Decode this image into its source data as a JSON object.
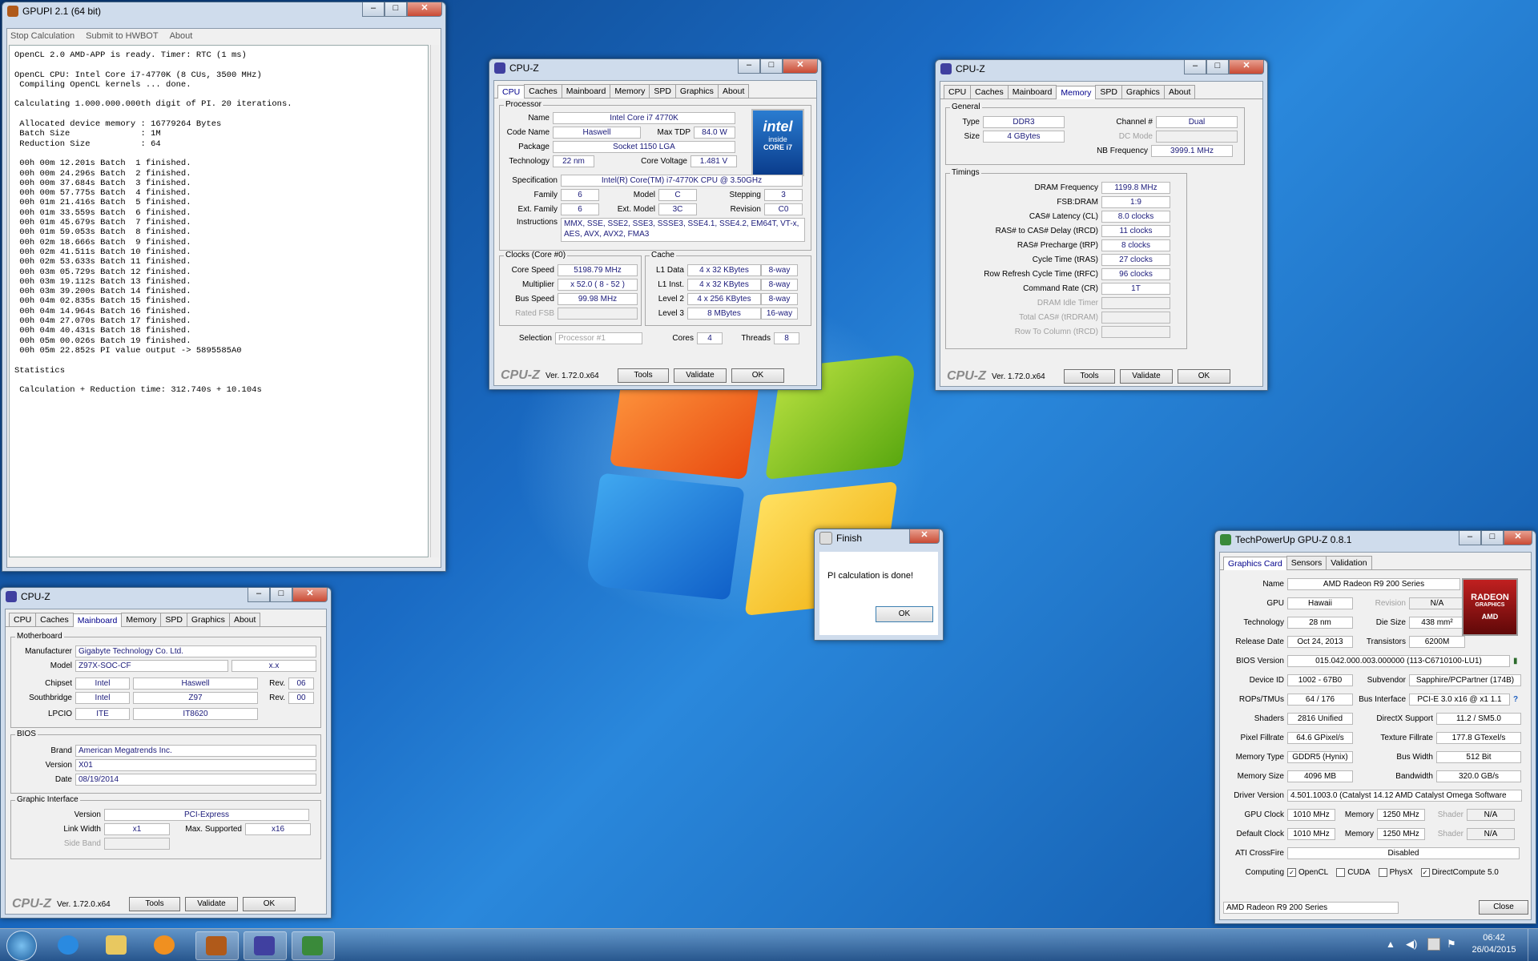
{
  "gpupi": {
    "title": "GPUPI 2.1 (64 bit)",
    "menu": [
      "Stop Calculation",
      "Submit to HWBOT",
      "About"
    ],
    "console": "OpenCL 2.0 AMD-APP is ready. Timer: RTC (1 ms)\n\nOpenCL CPU: Intel Core i7-4770K (8 CUs, 3500 MHz)\n Compiling OpenCL kernels ... done.\n\nCalculating 1.000.000.000th digit of PI. 20 iterations.\n\n Allocated device memory : 16779264 Bytes\n Batch Size              : 1M\n Reduction Size          : 64\n\n 00h 00m 12.201s Batch  1 finished.\n 00h 00m 24.296s Batch  2 finished.\n 00h 00m 37.684s Batch  3 finished.\n 00h 00m 57.775s Batch  4 finished.\n 00h 01m 21.416s Batch  5 finished.\n 00h 01m 33.559s Batch  6 finished.\n 00h 01m 45.679s Batch  7 finished.\n 00h 01m 59.053s Batch  8 finished.\n 00h 02m 18.666s Batch  9 finished.\n 00h 02m 41.511s Batch 10 finished.\n 00h 02m 53.633s Batch 11 finished.\n 00h 03m 05.729s Batch 12 finished.\n 00h 03m 19.112s Batch 13 finished.\n 00h 03m 39.200s Batch 14 finished.\n 00h 04m 02.835s Batch 15 finished.\n 00h 04m 14.964s Batch 16 finished.\n 00h 04m 27.070s Batch 17 finished.\n 00h 04m 40.431s Batch 18 finished.\n 00h 05m 00.026s Batch 19 finished.\n 00h 05m 22.852s PI value output -> 5895585A0\n\nStatistics\n\n Calculation + Reduction time: 312.740s + 10.104s"
  },
  "cpuz_cpu": {
    "title": "CPU-Z",
    "tabs": [
      "CPU",
      "Caches",
      "Mainboard",
      "Memory",
      "SPD",
      "Graphics",
      "About"
    ],
    "processor_label": "Processor",
    "name_label": "Name",
    "name": "Intel Core i7 4770K",
    "codename_label": "Code Name",
    "codename": "Haswell",
    "maxtdp_label": "Max TDP",
    "maxtdp": "84.0 W",
    "package_label": "Package",
    "package": "Socket 1150 LGA",
    "technology_label": "Technology",
    "technology": "22 nm",
    "voltage_label": "Core Voltage",
    "voltage": "1.481 V",
    "spec_label": "Specification",
    "spec": "Intel(R) Core(TM) i7-4770K CPU @ 3.50GHz",
    "family_label": "Family",
    "family": "6",
    "model_label": "Model",
    "model": "C",
    "stepping_label": "Stepping",
    "stepping": "3",
    "extfamily_label": "Ext. Family",
    "extfamily": "6",
    "extmodel_label": "Ext. Model",
    "extmodel": "3C",
    "revision_label": "Revision",
    "revision": "C0",
    "instr_label": "Instructions",
    "instr": "MMX, SSE, SSE2, SSE3, SSSE3, SSE4.1, SSE4.2, EM64T, VT-x, AES, AVX, AVX2, FMA3",
    "clocks_label": "Clocks (Core #0)",
    "corespeed_label": "Core Speed",
    "corespeed": "5198.79 MHz",
    "multiplier_label": "Multiplier",
    "multiplier": "x 52.0 ( 8 - 52 )",
    "busspeed_label": "Bus Speed",
    "busspeed": "99.98 MHz",
    "ratedfsb_label": "Rated FSB",
    "cache_label": "Cache",
    "l1d_label": "L1 Data",
    "l1d": "4 x 32 KBytes",
    "l1d_way": "8-way",
    "l1i_label": "L1 Inst.",
    "l1i": "4 x 32 KBytes",
    "l1i_way": "8-way",
    "l2_label": "Level 2",
    "l2": "4 x 256 KBytes",
    "l2_way": "8-way",
    "l3_label": "Level 3",
    "l3": "8 MBytes",
    "l3_way": "16-way",
    "selection_label": "Selection",
    "selection": "Processor #1",
    "cores_label": "Cores",
    "cores": "4",
    "threads_label": "Threads",
    "threads": "8",
    "intel_logo": [
      "intel",
      "inside",
      "CORE i7"
    ]
  },
  "cpuz_mem": {
    "title": "CPU-Z",
    "tabs": [
      "CPU",
      "Caches",
      "Mainboard",
      "Memory",
      "SPD",
      "Graphics",
      "About"
    ],
    "general_label": "General",
    "type_label": "Type",
    "type": "DDR3",
    "channel_label": "Channel #",
    "channel": "Dual",
    "size_label": "Size",
    "size": "4 GBytes",
    "dcmode_label": "DC Mode",
    "nbfreq_label": "NB Frequency",
    "nbfreq": "3999.1 MHz",
    "timings_label": "Timings",
    "timings": [
      {
        "label": "DRAM Frequency",
        "value": "1199.8 MHz",
        "dim": false
      },
      {
        "label": "FSB:DRAM",
        "value": "1:9",
        "dim": false
      },
      {
        "label": "CAS# Latency (CL)",
        "value": "8.0 clocks",
        "dim": false
      },
      {
        "label": "RAS# to CAS# Delay (tRCD)",
        "value": "11 clocks",
        "dim": false
      },
      {
        "label": "RAS# Precharge (tRP)",
        "value": "8 clocks",
        "dim": false
      },
      {
        "label": "Cycle Time (tRAS)",
        "value": "27 clocks",
        "dim": false
      },
      {
        "label": "Row Refresh Cycle Time (tRFC)",
        "value": "96 clocks",
        "dim": false
      },
      {
        "label": "Command Rate (CR)",
        "value": "1T",
        "dim": false
      },
      {
        "label": "DRAM Idle Timer",
        "value": "",
        "dim": true
      },
      {
        "label": "Total CAS# (tRDRAM)",
        "value": "",
        "dim": true
      },
      {
        "label": "Row To Column (tRCD)",
        "value": "",
        "dim": true
      }
    ]
  },
  "cpuz_mb": {
    "title": "CPU-Z",
    "tabs": [
      "CPU",
      "Caches",
      "Mainboard",
      "Memory",
      "SPD",
      "Graphics",
      "About"
    ],
    "motherboard_label": "Motherboard",
    "manufacturer_label": "Manufacturer",
    "manufacturer": "Gigabyte Technology Co. Ltd.",
    "model_label": "Model",
    "model": "Z97X-SOC-CF",
    "model_rev": "x.x",
    "chipset_label": "Chipset",
    "chipset_vendor": "Intel",
    "chipset": "Haswell",
    "chipset_rev_label": "Rev.",
    "chipset_rev": "06",
    "southbridge_label": "Southbridge",
    "sb_vendor": "Intel",
    "sb": "Z97",
    "sb_rev_label": "Rev.",
    "sb_rev": "00",
    "lpcio_label": "LPCIO",
    "lpcio_vendor": "ITE",
    "lpcio": "IT8620",
    "bios_label": "BIOS",
    "brand_label": "Brand",
    "brand": "American Megatrends Inc.",
    "version_label": "Version",
    "version": "X01",
    "date_label": "Date",
    "date": "08/19/2014",
    "gi_label": "Graphic Interface",
    "gi_version_label": "Version",
    "gi_version": "PCI-Express",
    "linkwidth_label": "Link Width",
    "linkwidth": "x1",
    "maxsupported_label": "Max. Supported",
    "maxsupported": "x16",
    "sideband_label": "Side Band"
  },
  "cpuz_footer": {
    "logo": "CPU-Z",
    "version": "Ver. 1.72.0.x64",
    "tools": "Tools",
    "validate": "Validate",
    "ok": "OK"
  },
  "finish": {
    "title": "Finish",
    "message": "PI calculation is done!",
    "ok": "OK"
  },
  "gpuz": {
    "title": "TechPowerUp GPU-Z 0.8.1",
    "tabs": [
      "Graphics Card",
      "Sensors",
      "Validation"
    ],
    "name_label": "Name",
    "name": "AMD Radeon R9 200 Series",
    "gpu_label": "GPU",
    "gpu": "Hawaii",
    "revision_label": "Revision",
    "revision": "N/A",
    "technology_label": "Technology",
    "technology": "28 nm",
    "diesize_label": "Die Size",
    "diesize": "438 mm²",
    "release_label": "Release Date",
    "release": "Oct 24, 2013",
    "transistors_label": "Transistors",
    "transistors": "6200M",
    "bios_label": "BIOS Version",
    "bios": "015.042.000.003.000000 (113-C6710100-LU1)",
    "deviceid_label": "Device ID",
    "deviceid": "1002 - 67B0",
    "subvendor_label": "Subvendor",
    "subvendor": "Sapphire/PCPartner (174B)",
    "rops_label": "ROPs/TMUs",
    "rops": "64 / 176",
    "businterface_label": "Bus Interface",
    "businterface": "PCI-E 3.0 x16 @ x1 1.1",
    "shaders_label": "Shaders",
    "shaders": "2816 Unified",
    "directx_label": "DirectX Support",
    "directx": "11.2 / SM5.0",
    "pixelfill_label": "Pixel Fillrate",
    "pixelfill": "64.6 GPixel/s",
    "texturefill_label": "Texture Fillrate",
    "texturefill": "177.8 GTexel/s",
    "memtype_label": "Memory Type",
    "memtype": "GDDR5 (Hynix)",
    "buswidth_label": "Bus Width",
    "buswidth": "512 Bit",
    "memsize_label": "Memory Size",
    "memsize": "4096 MB",
    "bandwidth_label": "Bandwidth",
    "bandwidth": "320.0 GB/s",
    "driver_label": "Driver Version",
    "driver": "4.501.1003.0 (Catalyst 14.12 AMD Catalyst Omega Software",
    "gpuclock_label": "GPU Clock",
    "gpuclock": "1010 MHz",
    "memory_label": "Memory",
    "memclock": "1250 MHz",
    "shader_label": "Shader",
    "shader": "N/A",
    "defclock_label": "Default Clock",
    "defclock": "1010 MHz",
    "defmem": "1250 MHz",
    "defshader": "N/A",
    "crossfire_label": "ATI CrossFire",
    "crossfire": "Disabled",
    "computing_label": "Computing",
    "computing": [
      {
        "label": "OpenCL",
        "checked": "✓"
      },
      {
        "label": "CUDA",
        "checked": ""
      },
      {
        "label": "PhysX",
        "checked": ""
      },
      {
        "label": "DirectCompute 5.0",
        "checked": "✓"
      }
    ],
    "card_select": "AMD Radeon R9 200 Series",
    "close": "Close",
    "radeon_logo": [
      "RADEON",
      "GRAPHICS",
      "AMD"
    ]
  },
  "taskbar": {
    "time": "06:42",
    "date": "26/04/2015"
  }
}
